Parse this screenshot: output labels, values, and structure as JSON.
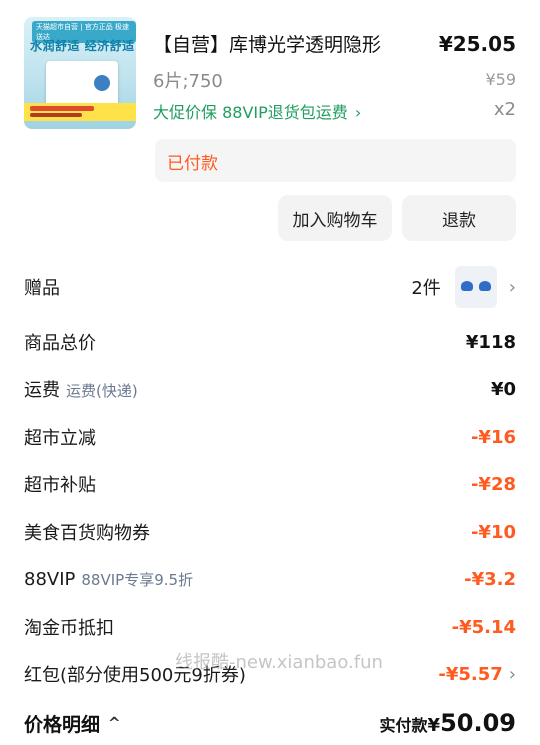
{
  "product": {
    "title": "【自营】库博光学透明隐形",
    "price": "¥25.05",
    "sku": "6片;750",
    "original_price": "¥59",
    "promo": "大促价保  88VIP退货包运费",
    "promo_chevron": "›",
    "quantity": "x2",
    "status": "已付款",
    "thumb": {
      "badge": "天猫超市自营 | 官方正品 极速送达",
      "headline": "水润舒适 经济舒适"
    }
  },
  "actions": {
    "add_to_cart": "加入购物车",
    "refund": "退款"
  },
  "rows": [
    {
      "label": "赠品",
      "sub": "",
      "value": "2件"
    },
    {
      "label": "商品总价",
      "sub": "",
      "value": "¥118"
    },
    {
      "label": "运费",
      "sub": "运费(快递)",
      "value": "¥0"
    },
    {
      "label": "超市立减",
      "sub": "",
      "value": "-¥16"
    },
    {
      "label": "超市补贴",
      "sub": "",
      "value": "-¥28"
    },
    {
      "label": "美食百货购物券",
      "sub": "",
      "value": "-¥10"
    },
    {
      "label": "88VIP",
      "sub": "88VIP专享9.5折",
      "value": "-¥3.2"
    },
    {
      "label": "淘金币抵扣",
      "sub": "",
      "value": "-¥5.14"
    },
    {
      "label": "红包(部分使用500元9折券)",
      "sub": "",
      "value": "-¥5.57"
    }
  ],
  "watermark": "线报酷-new.xianbao.fun",
  "footer": {
    "detail_label": "价格明细",
    "detail_arrow": "^",
    "total_label": "实付款",
    "currency": "¥",
    "total_value": "50.09"
  },
  "icons": {
    "chevron_right": "›",
    "chevron_up": "^"
  },
  "colors": {
    "discount": "#ff5a1f",
    "promo": "#1f9e5e",
    "sub_label": "#6b7a8f"
  }
}
